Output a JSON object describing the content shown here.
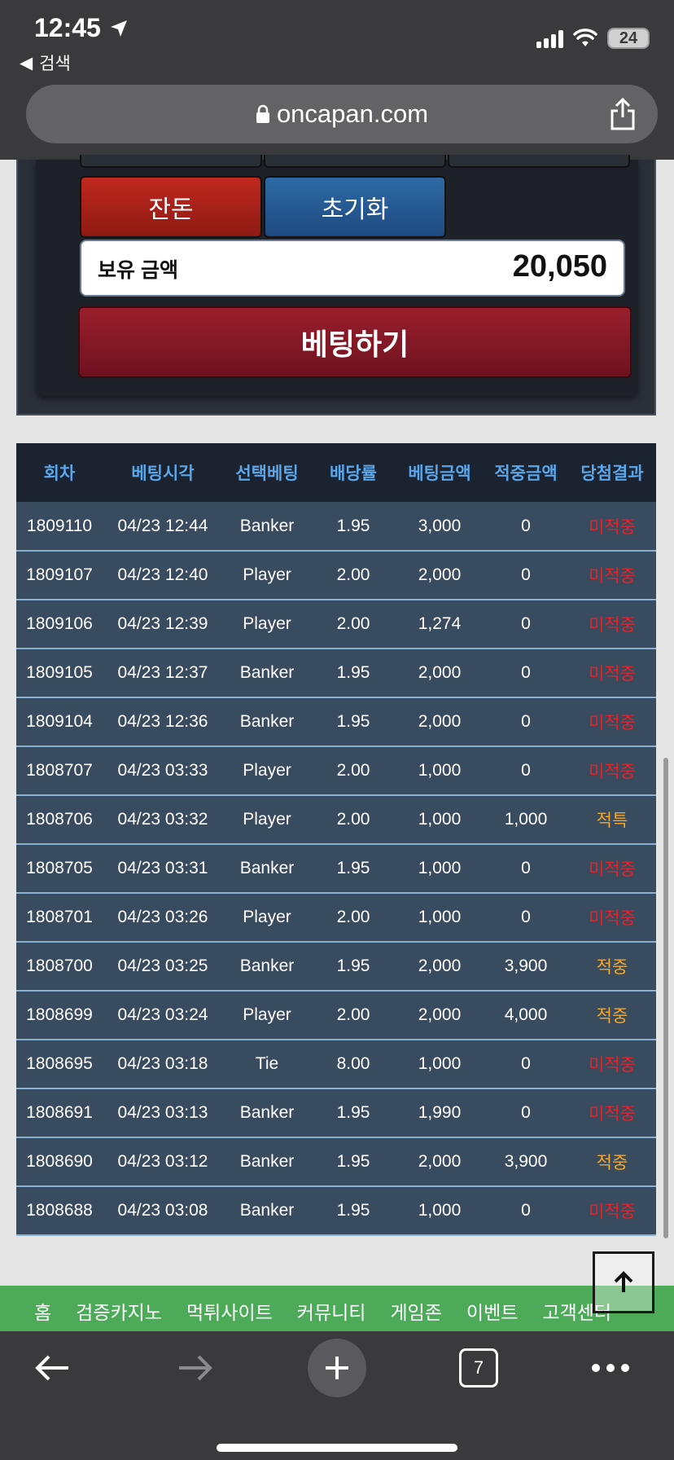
{
  "status_bar": {
    "time": "12:45",
    "back_app": "검색",
    "battery": "24"
  },
  "browser": {
    "url": "oncapan.com",
    "tab_count": "7"
  },
  "panel": {
    "reset_left_label": "잔돈",
    "reset_label": "초기화",
    "balance_label": "보유 금액",
    "balance_value": "20,050",
    "bet_label": "베팅하기"
  },
  "table": {
    "headers": [
      "회차",
      "베팅시각",
      "선택베팅",
      "배당률",
      "베팅금액",
      "적중금액",
      "당첨결과"
    ],
    "rows": [
      {
        "round": "1809110",
        "time": "04/23 12:44",
        "pick": "Banker",
        "odds": "1.95",
        "bet": "3,000",
        "win": "0",
        "result": "미적중",
        "status": "lose"
      },
      {
        "round": "1809107",
        "time": "04/23 12:40",
        "pick": "Player",
        "odds": "2.00",
        "bet": "2,000",
        "win": "0",
        "result": "미적중",
        "status": "lose"
      },
      {
        "round": "1809106",
        "time": "04/23 12:39",
        "pick": "Player",
        "odds": "2.00",
        "bet": "1,274",
        "win": "0",
        "result": "미적중",
        "status": "lose"
      },
      {
        "round": "1809105",
        "time": "04/23 12:37",
        "pick": "Banker",
        "odds": "1.95",
        "bet": "2,000",
        "win": "0",
        "result": "미적중",
        "status": "lose"
      },
      {
        "round": "1809104",
        "time": "04/23 12:36",
        "pick": "Banker",
        "odds": "1.95",
        "bet": "2,000",
        "win": "0",
        "result": "미적중",
        "status": "lose"
      },
      {
        "round": "1808707",
        "time": "04/23 03:33",
        "pick": "Player",
        "odds": "2.00",
        "bet": "1,000",
        "win": "0",
        "result": "미적중",
        "status": "lose"
      },
      {
        "round": "1808706",
        "time": "04/23 03:32",
        "pick": "Player",
        "odds": "2.00",
        "bet": "1,000",
        "win": "1,000",
        "result": "적특",
        "status": "win"
      },
      {
        "round": "1808705",
        "time": "04/23 03:31",
        "pick": "Banker",
        "odds": "1.95",
        "bet": "1,000",
        "win": "0",
        "result": "미적중",
        "status": "lose"
      },
      {
        "round": "1808701",
        "time": "04/23 03:26",
        "pick": "Player",
        "odds": "2.00",
        "bet": "1,000",
        "win": "0",
        "result": "미적중",
        "status": "lose"
      },
      {
        "round": "1808700",
        "time": "04/23 03:25",
        "pick": "Banker",
        "odds": "1.95",
        "bet": "2,000",
        "win": "3,900",
        "result": "적중",
        "status": "win"
      },
      {
        "round": "1808699",
        "time": "04/23 03:24",
        "pick": "Player",
        "odds": "2.00",
        "bet": "2,000",
        "win": "4,000",
        "result": "적중",
        "status": "win"
      },
      {
        "round": "1808695",
        "time": "04/23 03:18",
        "pick": "Tie",
        "odds": "8.00",
        "bet": "1,000",
        "win": "0",
        "result": "미적중",
        "status": "lose"
      },
      {
        "round": "1808691",
        "time": "04/23 03:13",
        "pick": "Banker",
        "odds": "1.95",
        "bet": "1,990",
        "win": "0",
        "result": "미적중",
        "status": "lose"
      },
      {
        "round": "1808690",
        "time": "04/23 03:12",
        "pick": "Banker",
        "odds": "1.95",
        "bet": "2,000",
        "win": "3,900",
        "result": "적중",
        "status": "win"
      },
      {
        "round": "1808688",
        "time": "04/23 03:08",
        "pick": "Banker",
        "odds": "1.95",
        "bet": "1,000",
        "win": "0",
        "result": "미적중",
        "status": "lose"
      }
    ]
  },
  "site_nav": [
    "홈",
    "검증카지노",
    "먹튀사이트",
    "커뮤니티",
    "게임존",
    "이벤트",
    "고객센터"
  ],
  "colors": {
    "lose": "#e0242a",
    "win": "#f0a830",
    "header_text": "#5aa6e8",
    "nav_green": "#4caa58"
  }
}
